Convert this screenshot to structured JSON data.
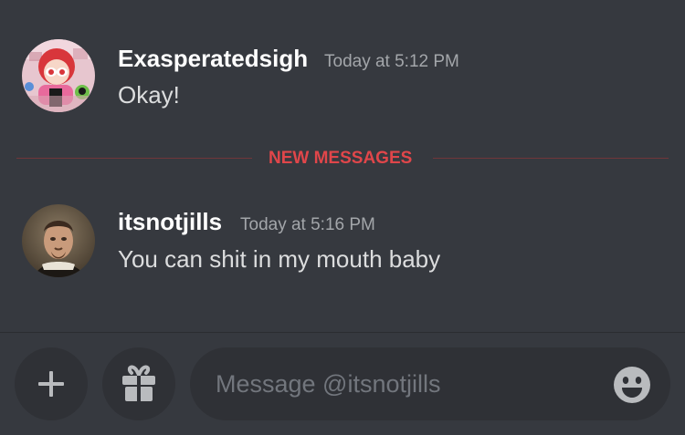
{
  "messages": [
    {
      "username": "Exasperatedsigh",
      "timestamp": "Today at 5:12 PM",
      "content": "Okay!"
    },
    {
      "username": "itsnotjills",
      "timestamp": "Today at 5:16 PM",
      "content": "You can shit in my mouth baby"
    }
  ],
  "divider": {
    "label": "NEW MESSAGES"
  },
  "composer": {
    "placeholder": "Message @itsnotjills",
    "icons": [
      "plus-icon",
      "gift-icon",
      "emoji-icon"
    ]
  },
  "colors": {
    "background": "#36393f",
    "input_background": "#2f3136",
    "new_messages_red": "#e0464a",
    "username": "#ffffff",
    "message_text": "#dcddde",
    "timestamp": "#a3a6aa"
  }
}
